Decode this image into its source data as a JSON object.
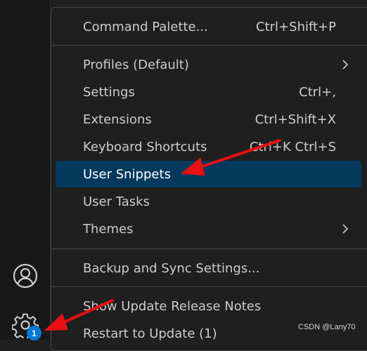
{
  "menu": {
    "items": [
      {
        "label": "Command Palette...",
        "key": "Ctrl+Shift+P"
      },
      {
        "label": "Profiles (Default)",
        "key": ""
      },
      {
        "label": "Settings",
        "key": "Ctrl+,"
      },
      {
        "label": "Extensions",
        "key": "Ctrl+Shift+X"
      },
      {
        "label": "Keyboard Shortcuts",
        "key": "Ctrl+K Ctrl+S"
      },
      {
        "label": "User Snippets",
        "key": ""
      },
      {
        "label": "User Tasks",
        "key": ""
      },
      {
        "label": "Themes",
        "key": ""
      },
      {
        "label": "Backup and Sync Settings...",
        "key": ""
      },
      {
        "label": "Show Update Release Notes",
        "key": ""
      },
      {
        "label": "Restart to Update (1)",
        "key": ""
      }
    ]
  },
  "activity_bar": {
    "account_icon": "account-icon",
    "manage_icon": "gear-icon",
    "manage_badge": "1"
  },
  "watermark": "CSDN @Lany70",
  "colors": {
    "accent": "#04395e",
    "badge": "#0078d4",
    "annotation_arrow": "#e81010"
  }
}
